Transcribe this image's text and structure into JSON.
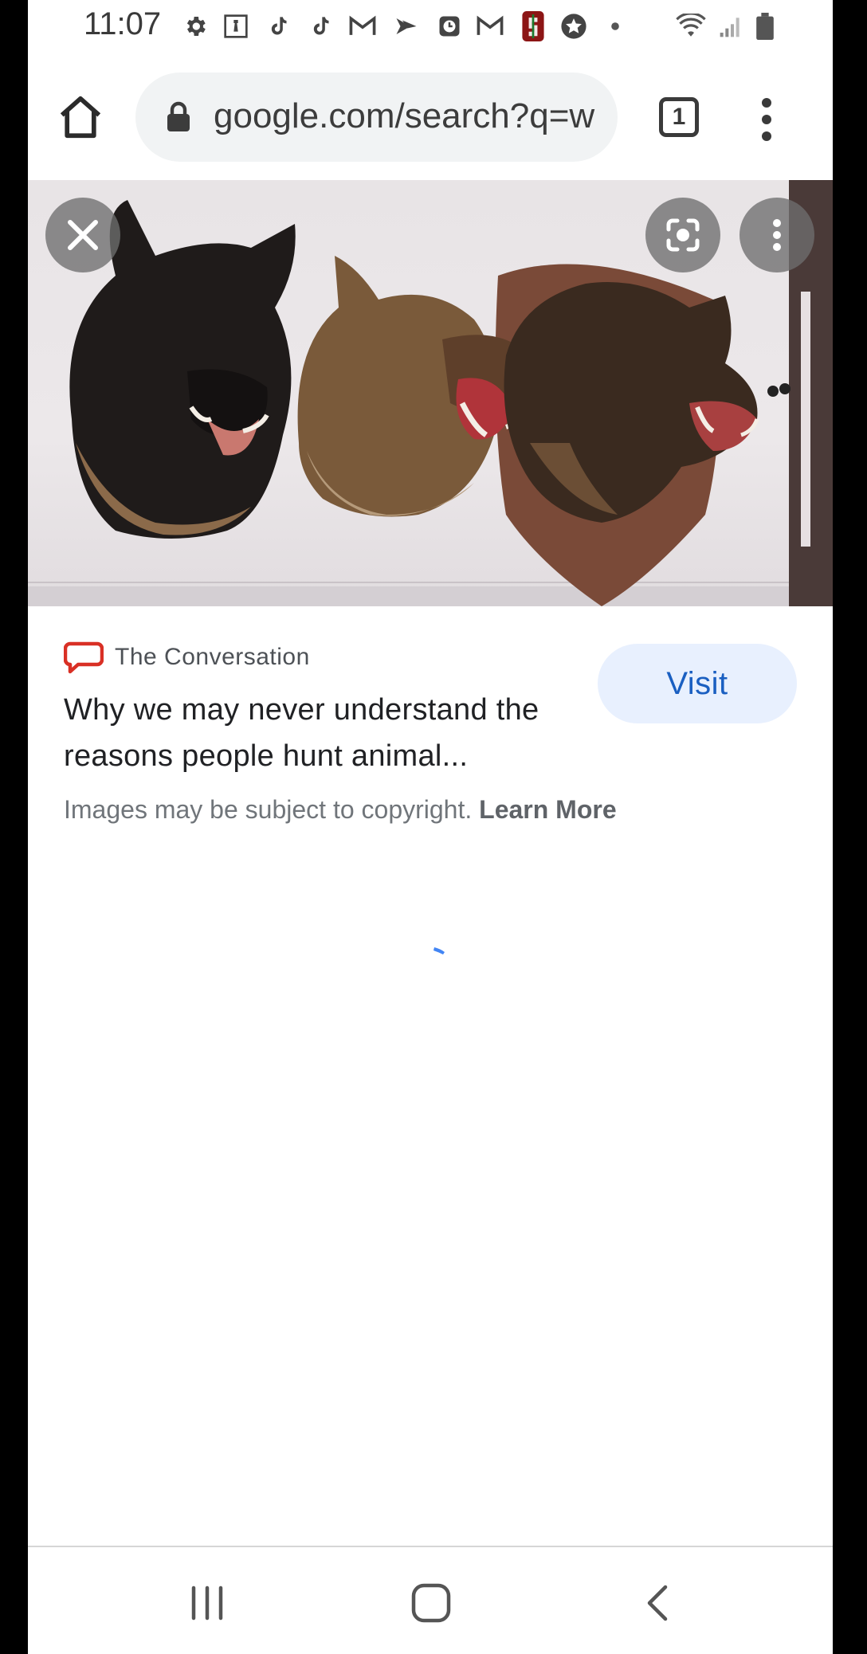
{
  "status_bar": {
    "time": "11:07",
    "notification_icons": [
      "settings-icon",
      "chess-icon",
      "tiktok-icon",
      "tiktok-icon",
      "gmail-icon",
      "sprint-icon",
      "clock-app-icon",
      "gmail-icon",
      "stanford-icon",
      "star-icon",
      "dot-icon"
    ],
    "system_icons": [
      "wifi-icon",
      "cell-signal-icon",
      "battery-icon"
    ]
  },
  "browser": {
    "url": "google.com/search?q=w",
    "tab_count": "1"
  },
  "preview": {
    "subject": "three mounted boar heads"
  },
  "result": {
    "source_name": "The Conversation",
    "title": "Why we may never understand the reasons people hunt animal...",
    "visit_label": "Visit",
    "copyright_text": "Images may be subject to copyright.",
    "learn_more_label": "Learn More"
  },
  "colors": {
    "visit_bg": "#e8f0fe",
    "visit_text": "#1a5fc1",
    "source_logo": "#d93025",
    "spinner": "#4285f4"
  }
}
